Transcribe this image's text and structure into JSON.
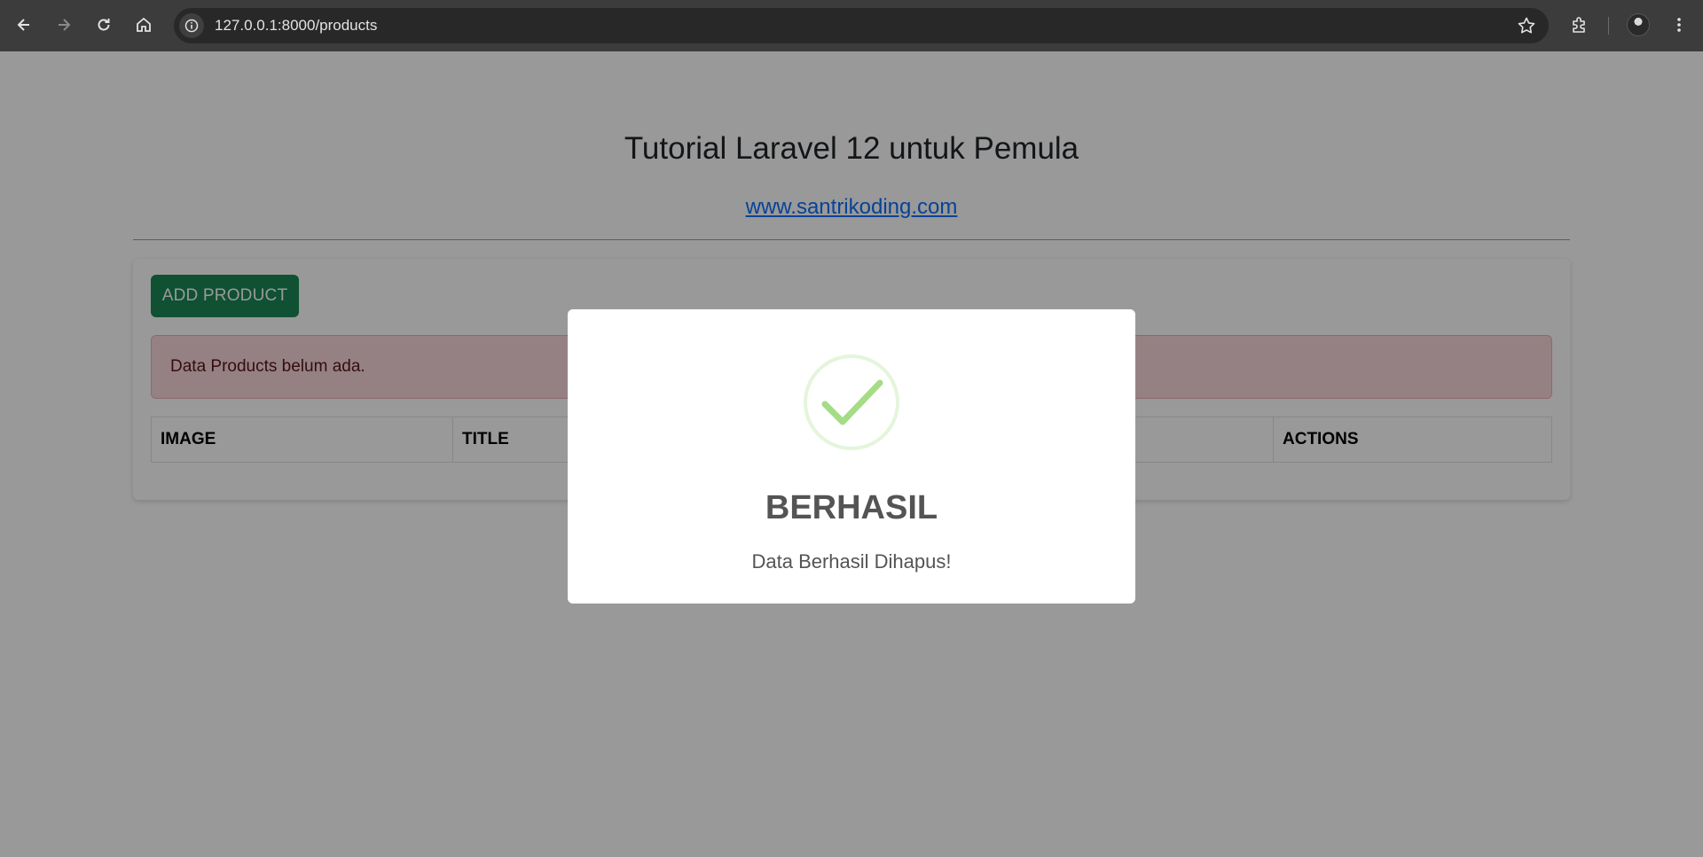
{
  "browser": {
    "url": "127.0.0.1:8000/products"
  },
  "header": {
    "title": "Tutorial Laravel 12 untuk Pemula",
    "link": "www.santrikoding.com"
  },
  "card": {
    "add_button": "ADD PRODUCT",
    "empty_alert": "Data Products belum ada.",
    "table_headers": [
      "IMAGE",
      "TITLE",
      "",
      "",
      "ACTIONS"
    ]
  },
  "modal": {
    "title": "BERHASIL",
    "text": "Data Berhasil Dihapus!",
    "icon": "success-check-icon"
  },
  "colors": {
    "success": "#198754",
    "check": "#a5dc86",
    "link": "#0d6efd",
    "alert_bg": "#f8d7da"
  }
}
